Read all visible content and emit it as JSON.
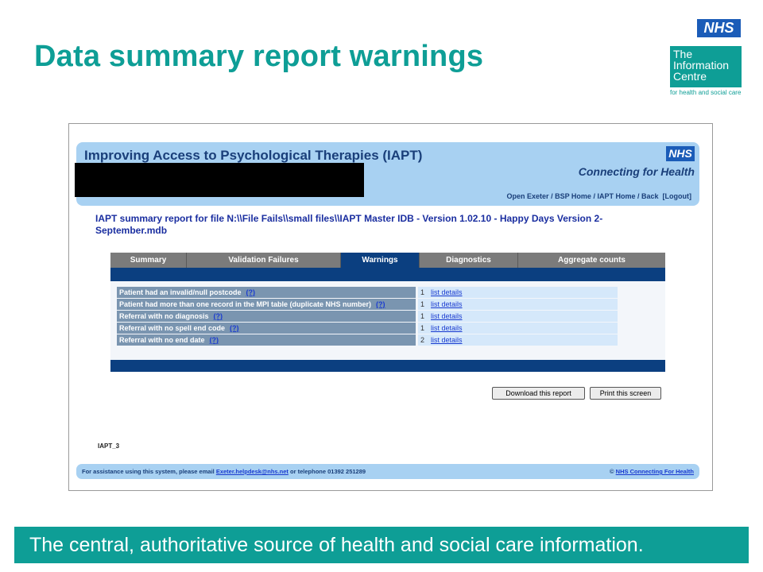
{
  "slide": {
    "title": "Data summary report warnings",
    "tagline": "The central, authoritative source of health and social care information."
  },
  "logo": {
    "nhs": "NHS",
    "line1": "The",
    "line2": "Information",
    "line3": "Centre",
    "tag": "for health and social care"
  },
  "app": {
    "title": "Improving Access to Psychological Therapies (IAPT)",
    "nhs_badge": "NHS",
    "cfh": "Connecting for Health",
    "nav": {
      "open_exeter": "Open Exeter",
      "bsp_home": "BSP Home",
      "iapt_home": "IAPT Home",
      "back": "Back",
      "logout": "[Logout]",
      "sep": " / "
    },
    "report_title": "IAPT summary report for file N:\\\\File Fails\\\\small files\\\\IAPT Master IDB - Version 1.02.10 - Happy Days Version 2-September.mdb",
    "tabs": [
      {
        "label": "Summary",
        "active": false
      },
      {
        "label": "Validation Failures",
        "active": false
      },
      {
        "label": "Warnings",
        "active": true
      },
      {
        "label": "Diagnostics",
        "active": false
      },
      {
        "label": "Aggregate counts",
        "active": false
      }
    ],
    "warnings": [
      {
        "label": "Patient had an invalid/null postcode",
        "help": "(?)",
        "count": "1",
        "details": "list details"
      },
      {
        "label": "Patient had more than one record in the MPI table (duplicate NHS number)",
        "help": "(?)",
        "count": "1",
        "details": "list details"
      },
      {
        "label": "Referral with no diagnosis",
        "help": "(?)",
        "count": "1",
        "details": "list details"
      },
      {
        "label": "Referral with no spell end code",
        "help": "(?)",
        "count": "1",
        "details": "list details"
      },
      {
        "label": "Referral with no end date",
        "help": "(?)",
        "count": "2",
        "details": "list details"
      }
    ],
    "buttons": {
      "download": "Download this report",
      "print": "Print this screen"
    },
    "page_code": "IAPT_3",
    "footer": {
      "prefix": "For assistance using this system, please email ",
      "email": "Exeter.helpdesk@nhs.net",
      "suffix": " or telephone 01392 251289",
      "copyright": "© ",
      "cfh_link": "NHS Connecting For Health"
    }
  }
}
